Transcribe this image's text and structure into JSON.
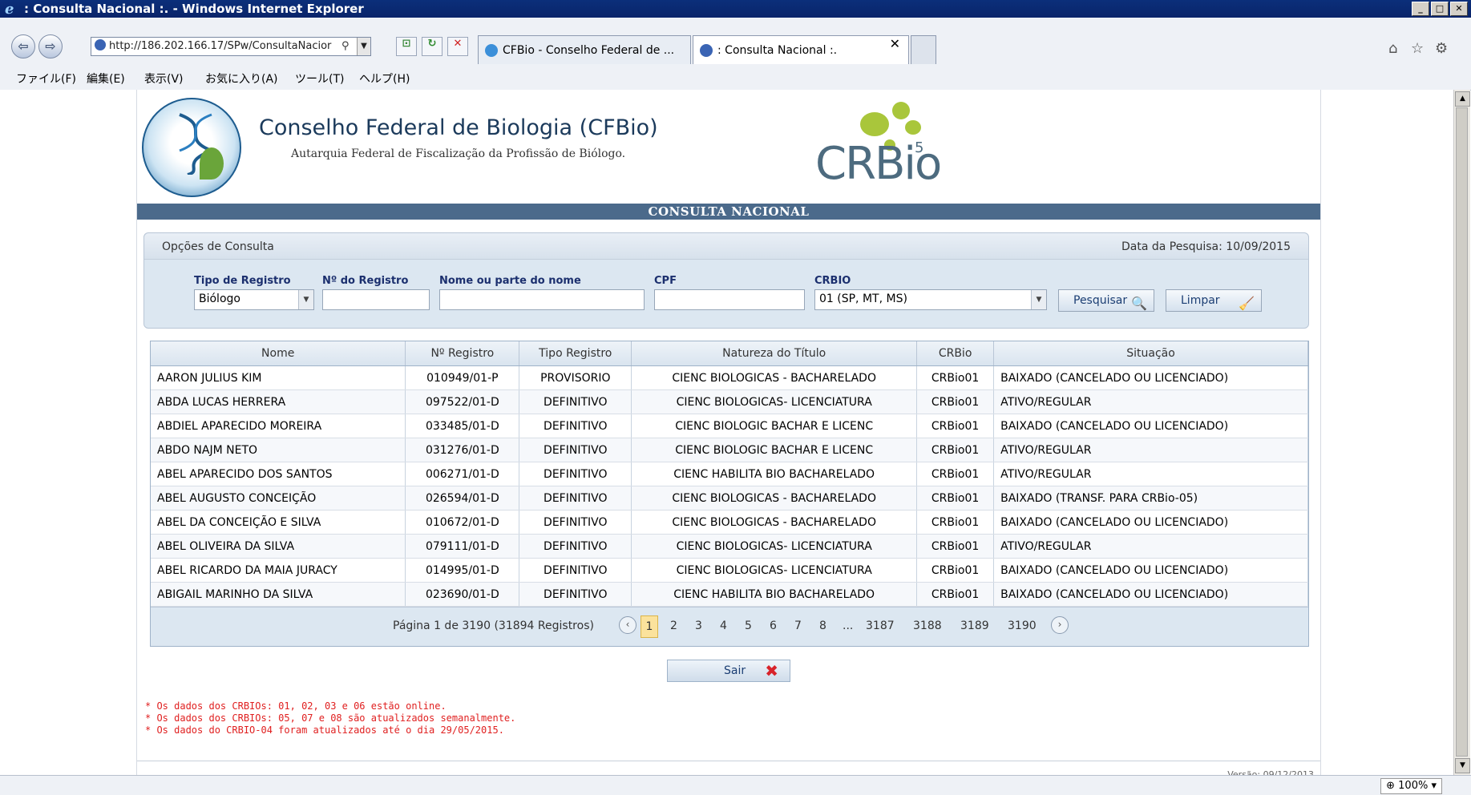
{
  "browser": {
    "window_title": ": Consulta Nacional :. - Windows Internet Explorer",
    "address": "http://186.202.166.17/SPw/ConsultaNacior",
    "tabs": [
      {
        "label": "CFBio - Conselho Federal de ..."
      },
      {
        "label": ": Consulta Nacional :."
      }
    ],
    "menu": [
      "ファイル(F)",
      "編集(E)",
      "表示(V)",
      "お気に入り(A)",
      "ツール(T)",
      "ヘルプ(H)"
    ],
    "zoom": "100%"
  },
  "header": {
    "brand": "Conselho Federal de Biologia (CFBio)",
    "subtitle": "Autarquia Federal de Fiscalização da Profissão de Biólogo.",
    "crbio_logo": "CRBio",
    "crbio_number": "5",
    "section_title": "CONSULTA NACIONAL"
  },
  "options": {
    "title": "Opções de Consulta",
    "date_label": "Data da Pesquisa: 10/09/2015",
    "labels": {
      "tipo": "Tipo de Registro",
      "numero": "Nº do Registro",
      "nome": "Nome ou parte do nome",
      "cpf": "CPF",
      "crbio": "CRBIO"
    },
    "values": {
      "tipo": "Biólogo",
      "numero": "",
      "nome": "",
      "cpf": "",
      "crbio": "01 (SP, MT, MS)"
    },
    "search_button": "Pesquisar",
    "clear_button": "Limpar"
  },
  "table": {
    "columns": [
      "Nome",
      "Nº Registro",
      "Tipo Registro",
      "Natureza do Título",
      "CRBio",
      "Situação"
    ],
    "rows": [
      [
        "AARON JULIUS KIM",
        "010949/01-P",
        "PROVISORIO",
        "CIENC BIOLOGICAS - BACHARELADO",
        "CRBio01",
        "BAIXADO (CANCELADO OU LICENCIADO)"
      ],
      [
        "ABDA LUCAS HERRERA",
        "097522/01-D",
        "DEFINITIVO",
        "CIENC BIOLOGICAS- LICENCIATURA",
        "CRBio01",
        "ATIVO/REGULAR"
      ],
      [
        "ABDIEL APARECIDO MOREIRA",
        "033485/01-D",
        "DEFINITIVO",
        "CIENC BIOLOGIC BACHAR E LICENC",
        "CRBio01",
        "BAIXADO (CANCELADO OU LICENCIADO)"
      ],
      [
        "ABDO NAJM NETO",
        "031276/01-D",
        "DEFINITIVO",
        "CIENC BIOLOGIC BACHAR E LICENC",
        "CRBio01",
        "ATIVO/REGULAR"
      ],
      [
        "ABEL APARECIDO DOS SANTOS",
        "006271/01-D",
        "DEFINITIVO",
        "CIENC HABILITA BIO BACHARELADO",
        "CRBio01",
        "ATIVO/REGULAR"
      ],
      [
        "ABEL AUGUSTO CONCEIÇÃO",
        "026594/01-D",
        "DEFINITIVO",
        "CIENC BIOLOGICAS - BACHARELADO",
        "CRBio01",
        "BAIXADO (TRANSF. PARA CRBio-05)"
      ],
      [
        "ABEL DA CONCEIÇÃO E SILVA",
        "010672/01-D",
        "DEFINITIVO",
        "CIENC BIOLOGICAS - BACHARELADO",
        "CRBio01",
        "BAIXADO (CANCELADO OU LICENCIADO)"
      ],
      [
        "ABEL OLIVEIRA DA SILVA",
        "079111/01-D",
        "DEFINITIVO",
        "CIENC BIOLOGICAS- LICENCIATURA",
        "CRBio01",
        "ATIVO/REGULAR"
      ],
      [
        "ABEL RICARDO DA MAIA JURACY",
        "014995/01-D",
        "DEFINITIVO",
        "CIENC BIOLOGICAS- LICENCIATURA",
        "CRBio01",
        "BAIXADO (CANCELADO OU LICENCIADO)"
      ],
      [
        "ABIGAIL MARINHO DA SILVA",
        "023690/01-D",
        "DEFINITIVO",
        "CIENC HABILITA BIO BACHARELADO",
        "CRBio01",
        "BAIXADO (CANCELADO OU LICENCIADO)"
      ]
    ]
  },
  "pager": {
    "info": "Página 1 de 3190 (31894 Registros)",
    "pages": [
      "1",
      "2",
      "3",
      "4",
      "5",
      "6",
      "7",
      "8",
      "...",
      "3187",
      "3188",
      "3189",
      "3190"
    ],
    "current": "1"
  },
  "exit_button": "Sair",
  "notes": [
    "* Os dados dos CRBIOs: 01, 02, 03 e 06 estão online.",
    "* Os dados dos CRBIOs: 05, 07 e 08 são atualizados semanalmente.",
    "* Os dados do CRBIO-04 foram atualizados até o dia 29/05/2015."
  ],
  "version": "Versão: 09/12/2013",
  "colors": {
    "header_bar": "#4b6a8b",
    "notes": "#e02020",
    "current_page": "#fbe29c"
  }
}
